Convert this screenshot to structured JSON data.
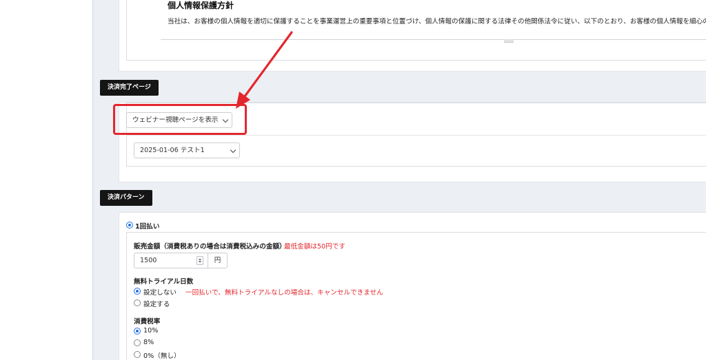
{
  "privacy": {
    "title": "個人情報保護方針",
    "text": "当社は、お客様の個人情報を適切に保護することを事業運営上の重要事項と位置づけ、個人情報の保護に関する法律その他関係法令に従い、以下のとおり、お客様の個人情報を細心の注意をも"
  },
  "completion_page": {
    "tag": "決済完了ページ",
    "page_select": {
      "selected": "ウェビナー視聴ページを表示"
    },
    "webinar_select": {
      "selected": "2025-01-06 テスト1"
    }
  },
  "payment_pattern": {
    "tag": "決済パターン",
    "one_time": {
      "label": "1回払い",
      "checked": true
    },
    "price": {
      "label": "販売金額（消費税ありの場合は消費税込みの金額）",
      "note": "最低金額は50円です",
      "value": "1500",
      "unit": "円"
    },
    "trial": {
      "label": "無料トライアル日数",
      "options": [
        {
          "label": "設定しない",
          "note": "一回払いで、無料トライアルなしの場合は、キャンセルできません",
          "checked": true
        },
        {
          "label": "設定する",
          "checked": false
        }
      ]
    },
    "tax": {
      "label": "消費税率",
      "options": [
        {
          "label": "10%",
          "checked": true
        },
        {
          "label": "8%",
          "checked": false
        },
        {
          "label": "0%（無し）",
          "checked": false
        }
      ]
    }
  },
  "colors": {
    "accent_red": "#e3262d",
    "radio_blue": "#1f6fe0",
    "tag_bg": "#151515",
    "page_bg": "#eceff3"
  }
}
